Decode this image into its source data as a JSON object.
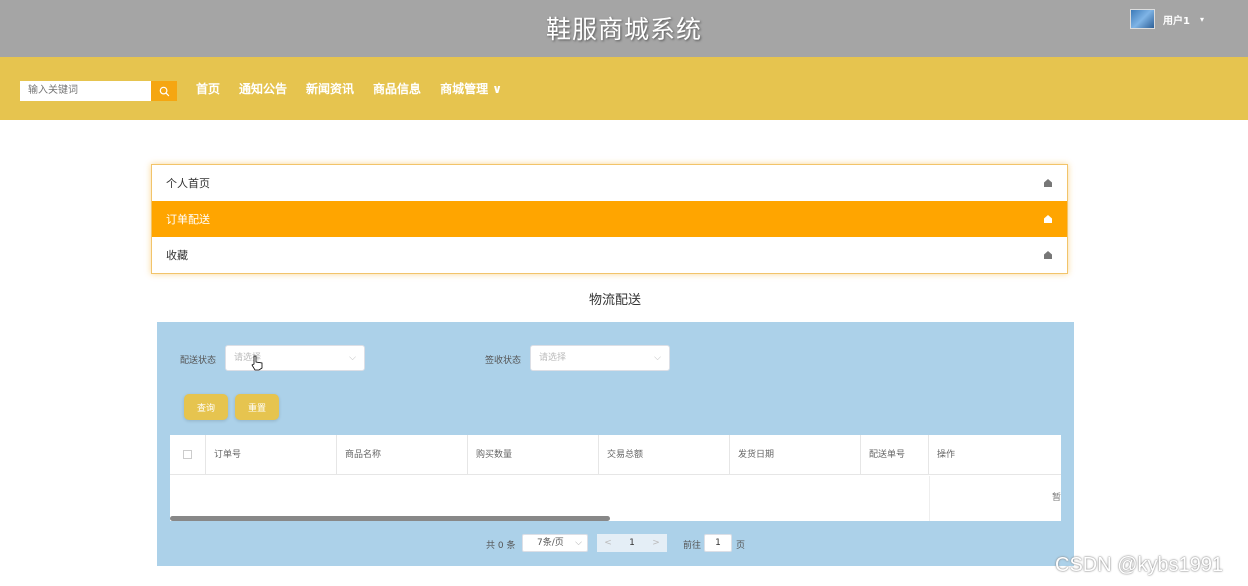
{
  "header": {
    "site_title": "鞋服商城系统",
    "user_name": "用户1",
    "caret": "▾"
  },
  "nav": {
    "search_placeholder": "输入关键词",
    "items": [
      "首页",
      "通知公告",
      "新闻资讯",
      "商品信息",
      "商城管理"
    ],
    "dropdown_caret": "∨"
  },
  "menu": {
    "items": [
      {
        "label": "个人首页",
        "active": false
      },
      {
        "label": "订单配送",
        "active": true
      },
      {
        "label": "收藏",
        "active": false
      }
    ]
  },
  "section": {
    "title": "物流配送"
  },
  "filters": {
    "delivery_status_label": "配送状态",
    "delivery_status_placeholder": "请选择",
    "receipt_status_label": "签收状态",
    "receipt_status_placeholder": "请选择",
    "query_button": "查询",
    "reset_button": "重置"
  },
  "table": {
    "columns": [
      "订单号",
      "商品名称",
      "购买数量",
      "交易总额",
      "发货日期",
      "配送单号",
      "操作"
    ],
    "empty_text": "暂"
  },
  "pagination": {
    "total": "共 0 条",
    "page_size": "7条/页",
    "current_page": "1",
    "goto_label": "前往",
    "goto_value": "1",
    "page_suffix": "页",
    "prev": "<",
    "next": ">"
  },
  "watermark": "CSDN @kybs1991",
  "colors": {
    "topbar": "#a5a5a5",
    "navbar": "#e6c44f",
    "accent": "#ffa500",
    "panel": "#acd1e9"
  }
}
